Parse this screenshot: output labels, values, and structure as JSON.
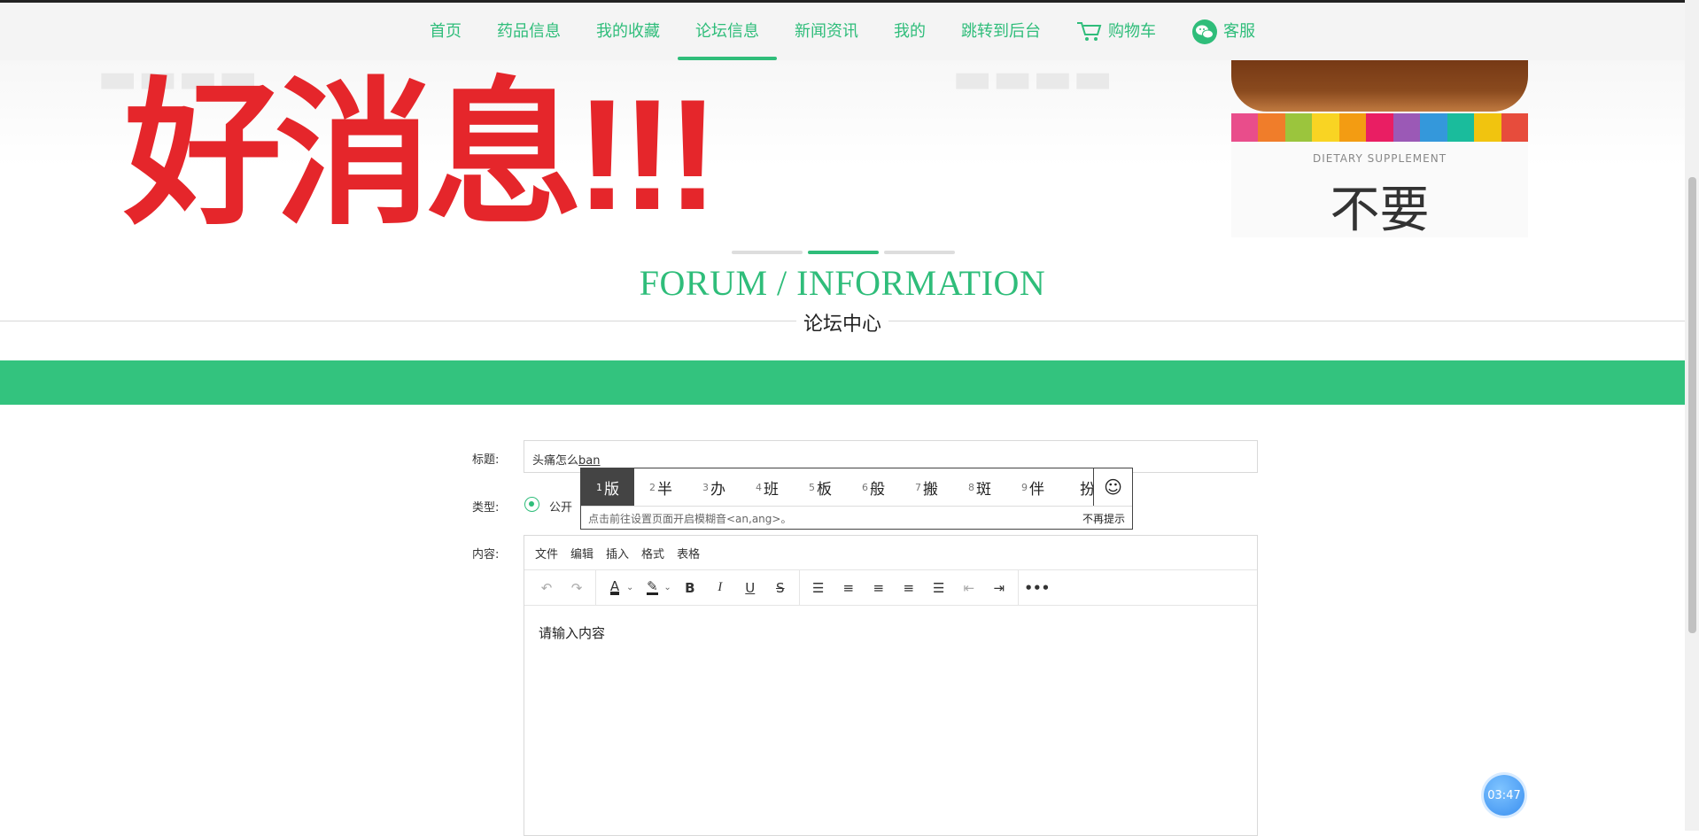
{
  "nav": {
    "items": [
      {
        "label": "首页",
        "active": false
      },
      {
        "label": "药品信息",
        "active": false
      },
      {
        "label": "我的收藏",
        "active": false
      },
      {
        "label": "论坛信息",
        "active": true
      },
      {
        "label": "新闻资讯",
        "active": false
      },
      {
        "label": "我的",
        "active": false
      },
      {
        "label": "跳转到后台",
        "active": false
      }
    ],
    "cart_label": "购物车",
    "service_label": "客服"
  },
  "banner": {
    "headline": "好消息!!!",
    "product_subtitle": "DIETARY SUPPLEMENT",
    "product_text": "不要"
  },
  "section": {
    "title_en": "FORUM / INFORMATION",
    "title_cn": "论坛中心"
  },
  "form": {
    "title_label": "标题:",
    "title_value_prefix": "头痛怎么",
    "title_value_composing": "ban",
    "type_label": "类型:",
    "type_option": "公开",
    "content_label": "内容:"
  },
  "editor": {
    "menu": [
      "文件",
      "编辑",
      "插入",
      "格式",
      "表格"
    ],
    "placeholder": "请输入内容"
  },
  "ime": {
    "candidates": [
      {
        "num": "1",
        "text": "版"
      },
      {
        "num": "2",
        "text": "半"
      },
      {
        "num": "3",
        "text": "办"
      },
      {
        "num": "4",
        "text": "班"
      },
      {
        "num": "5",
        "text": "板"
      },
      {
        "num": "6",
        "text": "般"
      },
      {
        "num": "7",
        "text": "搬"
      },
      {
        "num": "8",
        "text": "斑"
      },
      {
        "num": "9",
        "text": "伴"
      },
      {
        "num": "",
        "text": "扮"
      }
    ],
    "hint": "点击前往设置页面开启模糊音<an,ang>。",
    "dismiss": "不再提示"
  },
  "timer": "03:47",
  "colors": {
    "accent": "#2fbd7a",
    "banner_red": "#e5262b",
    "green_bar": "#33c37e"
  }
}
